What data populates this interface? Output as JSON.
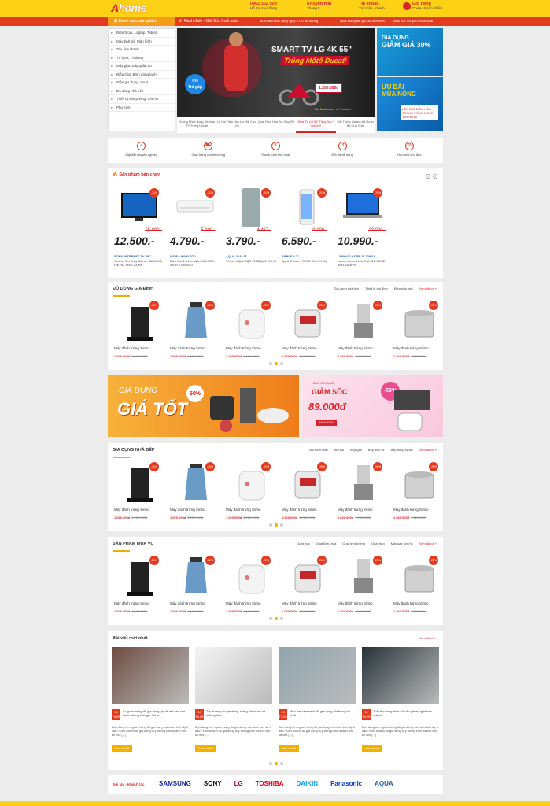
{
  "header": {
    "logo_a": "A",
    "logo_b": "home",
    "hotline": "0962 302 509",
    "hotline_sub": "Hỗ trợ mua hàng",
    "promo": "Khuyến mãi",
    "promo_sub": "Tháng 5",
    "account": "Tài khoản",
    "account_sub": "Xin chào, Khách",
    "cart": "Giỏ hàng",
    "cart_sub": "Chưa có sản phẩm"
  },
  "nav": {
    "categories": "Danh mục sản phẩm",
    "flash": "Flash Sale - Giá Sốc Cuối tuần",
    "promo1": "Mua Điều Hòa Tặng ngay 5 Ưu đãi khủng",
    "promo2": "Quạt mát giảm giá sốc đến 49%",
    "promo3": "Mua Tivi Trả góp 0% lãi suất"
  },
  "menu": [
    "Điện thoại, Laptop, Tablet",
    "Máy tính bộ, Màn hình",
    "Tivi, Âm thanh",
    "Tủ lạnh, Tủ đông",
    "Máy giặt, Sấy quần áo",
    "Điều hòa, Bình nóng lạnh",
    "Điện gia dụng, Quạt",
    "Đồ dùng nhà bếp",
    "Thiết bị văn phòng, máy in",
    "Phụ kiện"
  ],
  "slider": {
    "title": "SMART TV LG 4K 55\"",
    "sub": "Trúng Môtô Ducati",
    "badge1": "0%",
    "badge2": "Trả góp",
    "price": "1.200.000đ",
    "foot": "Bia Budweiser và Voucher"
  },
  "slider_tabs": [
    "Cuồng Nhiệt Bóng Đá Mua TV Trúng Ducati",
    "Lễ Hội Điều Hòa Ưu Đãi Cực Lớn",
    "Quạt Điều Hòa Trả Góp 0%",
    "Mua TV LG 55\" Tặng Bia + Voucher",
    "Đặt Trước Galaxy A8 Rước Bộ Quà Chất"
  ],
  "side_banners": {
    "b1_a": "GIA DỤNG",
    "b1_b": "GIẢM GIÁ 30%",
    "b2_a": "ƯU ĐÃI",
    "b2_b": "MÙA NÓNG",
    "b2_c": "LẮP ĐẶT ĐIỀU HÒA TRÚNG VÒNG 2 GIỜ 1900 6786"
  },
  "services": [
    {
      "icon": "✓",
      "label": "Lắp đặt chuyên nghiệp"
    },
    {
      "icon": "⛟",
      "label": "Giao hàng nhanh chóng"
    },
    {
      "icon": "$",
      "label": "Thanh toán linh hoạt"
    },
    {
      "icon": "↺",
      "label": "Đổi trả dễ dàng"
    },
    {
      "icon": "⚙",
      "label": "Hậu mãi chu đáo"
    }
  ],
  "best": {
    "title": "Sản phẩm bán chạy",
    "items": [
      {
        "disc": "-21%",
        "old": "15.900.-",
        "price": "12.500.-",
        "brand": "SONY INTERNET TV 48 \"",
        "name": "Internet Tivi Sony 48 inch 48W650D, Full HD, MXR 200Hz"
      },
      {
        "disc": "-21%",
        "old": "5.990.-",
        "price": "4.790.-",
        "brand": "MIDEA 9.000 BTU",
        "name": "Điều hòa 1 chiều Midea MS-MA1-09CR 9.000 BTU"
      },
      {
        "disc": "-21%",
        "old": "4.467.-",
        "price": "3.790.-",
        "brand": "AQUA 123 LÍT",
        "name": "Tủ lạnh AQua AQR-125BN(VS 123 Lít"
      },
      {
        "disc": "-21%",
        "old": "9.190.-",
        "price": "6.590.-",
        "brand": "APPLE 4.7\"",
        "name": "Apple iPhone 6 32GB Gold (VNA)"
      },
      {
        "disc": "-21%",
        "old": "13.990.-",
        "price": "10.990.-",
        "brand": "LENOVO CORE I5-7200U",
        "name": "Laptop Lenovo IdeaPad 320-15IKBN 80XL03ARVN"
      }
    ]
  },
  "sec1": {
    "title": "ĐỒ DÙNG GIA ĐÌNH",
    "cats": [
      "Gia dụng nhà bếp",
      "Thiết bị gia đình",
      "Điện nhà bếp"
    ],
    "more": "Xem tất cả »"
  },
  "sec2": {
    "title": "GIA DỤNG NHÀ BẾP",
    "cats": [
      "Nồi cơm điện",
      "Nồi lẩu",
      "Bếp gas",
      "Bếp điện từ",
      "Bếp hồng ngoại"
    ],
    "more": "Xem tất cả »"
  },
  "sec3": {
    "title": "SẢN PHẨM MÙA VỤ",
    "cats": [
      "Quạt mát",
      "Quạt Điều hòa",
      "Quạt treo tường",
      "Quạt trần",
      "Máy sấy sinh tố"
    ],
    "more": "Xem tất cả »"
  },
  "product": {
    "name": "Máy đánh trứng Sinbo",
    "price": "1.020.000đ",
    "old": "1.120.000đ",
    "disc": "-20%"
  },
  "ads": {
    "a1": "GIA DỤNG",
    "a2": "GIÁ TỐT",
    "a3": "50%",
    "b1": "HÀNG GIA DỤNG",
    "b2": "GIẢM SỐC",
    "b3": "89.000đ",
    "b4": "MUA NGAY",
    "b5": "-50%"
  },
  "blog": {
    "title": "Bài viết mới nhất",
    "more": "Xem tất cả »",
    "btn": "Xem chi tiết",
    "items": [
      {
        "day": "19",
        "mon": "Th.05",
        "title": "5 nguồn hàng đồ gia dụng giá rẻ mà các con buôn không bao giờ tiết lộ",
        "excerpt": "Bạn đang tìm nguồn hàng đồ gia dụng mà chưa biết lấy ở đâu? Kinh doanh đồ gia dụng là ý tưởng kinh doanh nhỏ tại nhà [...]"
      },
      {
        "day": "19",
        "mon": "Th.05",
        "title": "Thị trường đồ gia dụng: Hàng nội vươn về những thôn",
        "excerpt": "Bạn đang tìm nguồn hàng đồ gia dụng mà chưa biết lấy ở đâu? Kinh doanh đồ gia dụng là ý tưởng kinh doanh nhỏ tại nhà [...]"
      },
      {
        "day": "19",
        "mon": "Th.05",
        "title": "Mẹo hay làm sạch đồ gia dụng chỉ trong vài phút",
        "excerpt": "Bạn đang tìm nguồn hàng đồ gia dụng mà chưa biết lấy ở đâu? Kinh doanh đồ gia dụng là ý tưởng kinh doanh nhỏ tại nhà [...]"
      },
      {
        "day": "19",
        "mon": "Th.05",
        "title": "Tuổi thọ trung bình của đồ gia dụng là bao nhiêu?",
        "excerpt": "Bạn đang tìm nguồn hàng đồ gia dụng mà chưa biết lấy ở đâu? Kinh doanh đồ gia dụng là ý tưởng kinh doanh nhỏ tại nhà [...]"
      }
    ]
  },
  "partners": {
    "label": "Đối tác - Khách tác",
    "logos": [
      {
        "n": "SAMSUNG",
        "c": "#1428a0"
      },
      {
        "n": "SONY",
        "c": "#000000"
      },
      {
        "n": "LG",
        "c": "#a50034"
      },
      {
        "n": "TOSHIBA",
        "c": "#e60012"
      },
      {
        "n": "DAIKIN",
        "c": "#00a0e9"
      },
      {
        "n": "Panasonic",
        "c": "#0041c0"
      },
      {
        "n": "AQUA",
        "c": "#1d5aa8"
      }
    ]
  },
  "colors": {
    "brand": "#d8232a",
    "yellow": "#fcd116",
    "accent": "#f0b000"
  }
}
